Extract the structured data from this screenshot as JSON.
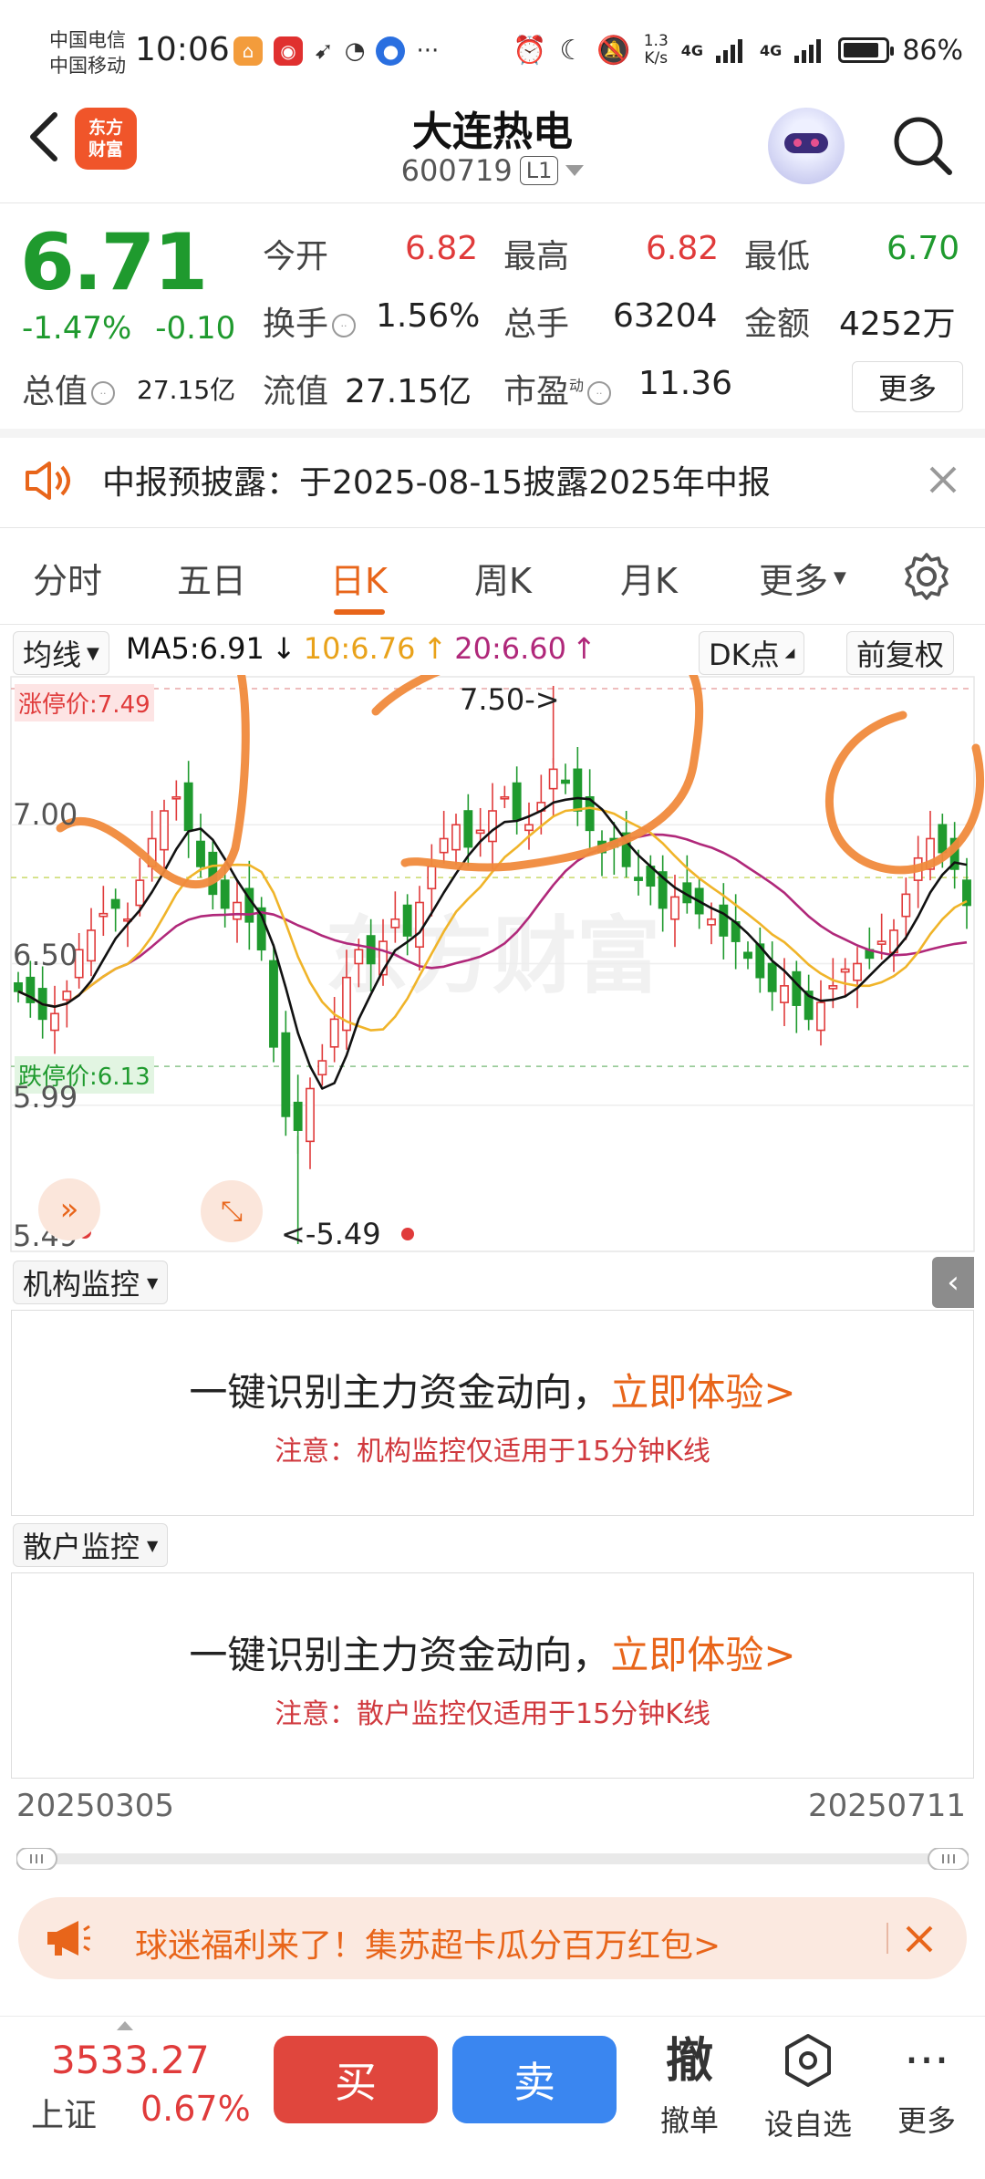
{
  "status_bar": {
    "carrier1": "中国电信",
    "carrier2": "中国移动",
    "time": "10:06",
    "net_speed_value": "1.3",
    "net_speed_unit": "K/s",
    "signal1": "4G",
    "signal2": "4G",
    "battery": "86%",
    "battery_level": 0.86
  },
  "header": {
    "logo_line1": "东方",
    "logo_line2": "财富",
    "title": "大连热电",
    "code": "600719",
    "level": "L1"
  },
  "quote": {
    "price": "6.71",
    "change_pct": "-1.47%",
    "change_abs": "-0.10",
    "open_label": "今开",
    "open": "6.82",
    "high_label": "最高",
    "high": "6.82",
    "low_label": "最低",
    "low": "6.70",
    "turnover_label": "换手",
    "turnover": "1.56%",
    "volume_label": "总手",
    "volume": "63204",
    "amount_label": "金额",
    "amount": "4252万",
    "mktcap_label": "总值",
    "mktcap": "27.15亿",
    "float_label": "流值",
    "float": "27.15亿",
    "pe_label": "市盈",
    "pe_sup": "动",
    "pe": "11.36",
    "more": "更多"
  },
  "notice": {
    "text": "中报预披露：于2025-08-15披露2025年中报"
  },
  "tabs": [
    {
      "label": "分时"
    },
    {
      "label": "五日"
    },
    {
      "label": "日K"
    },
    {
      "label": "周K"
    },
    {
      "label": "月K"
    },
    {
      "label": "更多"
    }
  ],
  "chart_toolbar": {
    "indicator": "均线",
    "ma5": "MA5:6.91",
    "ma10": "10:6.76",
    "ma20": "20:6.60",
    "dk": "DK点",
    "adjust": "前复权"
  },
  "chart_data": {
    "type": "candlestick",
    "y_ticks": [
      "7.00",
      "6.50",
      "5.99",
      "5.49"
    ],
    "limit_up_label": "涨停价:7.49",
    "limit_down_label": "跌停价:6.13",
    "high_marker": "7.50->",
    "low_marker": "<-5.49",
    "ylim": [
      5.49,
      7.5
    ],
    "x_start": "20250305",
    "x_end": "20250711",
    "ma_colors": {
      "ma5": "#111111",
      "ma10": "#f0b429",
      "ma20": "#b0287a"
    },
    "closes": [
      6.4,
      6.36,
      6.3,
      6.32,
      6.4,
      6.55,
      6.62,
      6.68,
      6.7,
      6.66,
      6.8,
      6.95,
      7.05,
      7.1,
      6.98,
      6.85,
      6.75,
      6.7,
      6.72,
      6.65,
      6.55,
      6.2,
      5.95,
      5.9,
      6.05,
      6.15,
      6.3,
      6.45,
      6.55,
      6.5,
      6.58,
      6.66,
      6.6,
      6.72,
      6.85,
      6.95,
      7.0,
      6.92,
      6.98,
      7.05,
      7.1,
      7.02,
      7.0,
      7.08,
      7.2,
      7.15,
      7.05,
      6.98,
      6.9,
      6.92,
      6.85,
      6.8,
      6.78,
      6.7,
      6.74,
      6.72,
      6.68,
      6.66,
      6.6,
      6.58,
      6.52,
      6.45,
      6.4,
      6.42,
      6.35,
      6.3,
      6.36,
      6.42,
      6.48,
      6.5,
      6.52,
      6.58,
      6.62,
      6.75,
      6.88,
      6.95,
      6.9,
      6.84,
      6.71
    ]
  },
  "institution_monitor": {
    "label": "机构监控",
    "main": "一键识别主力资金动向，",
    "link": "立即体验>",
    "note": "注意：机构监控仅适用于15分钟K线"
  },
  "retail_monitor": {
    "label": "散户监控",
    "main": "一键识别主力资金动向，",
    "link": "立即体验>",
    "note": "注意：散户监控仅适用于15分钟K线"
  },
  "ad": {
    "text": "球迷福利来了！集苏超卡瓜分百万红包>"
  },
  "bottom_bar": {
    "index_value": "3533.27",
    "index_name": "上证",
    "index_pct": "0.67%",
    "buy": "买",
    "sell": "卖",
    "cancel_icon": "撤",
    "cancel": "撤单",
    "watch": "设自选",
    "more": "更多"
  }
}
